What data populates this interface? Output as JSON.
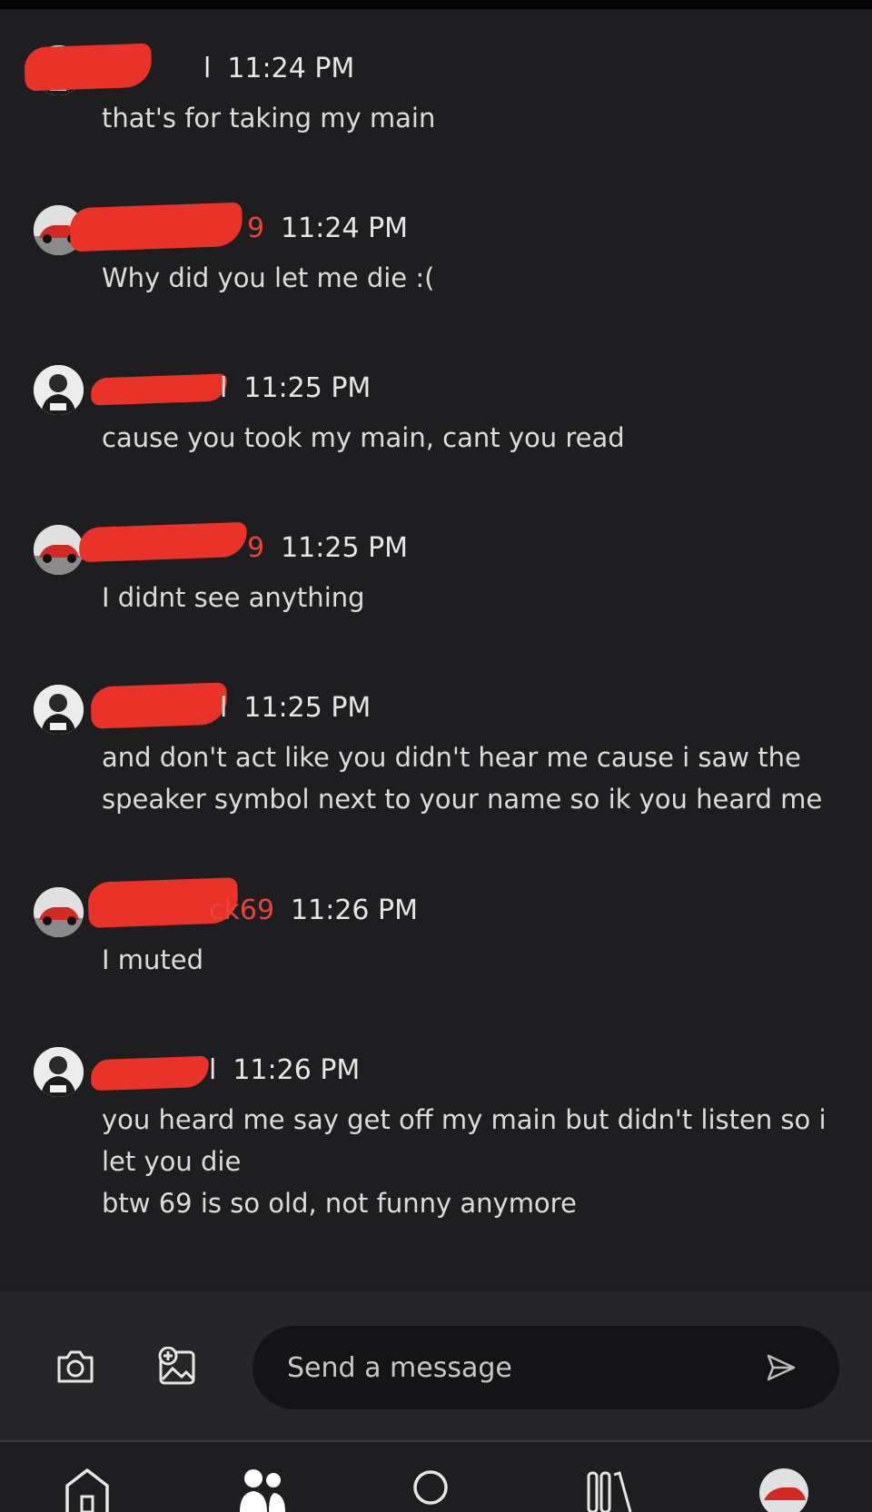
{
  "messages": [
    {
      "user": "l",
      "user_color": "#e9e9e9",
      "avatar": "person-avatar",
      "time": "11:24 PM",
      "text": "that's for taking my main"
    },
    {
      "user": "9",
      "user_color": "#e8443a",
      "avatar": "red-car-avatar",
      "time": "11:24 PM",
      "text": "Why did you let me die :("
    },
    {
      "user": "l",
      "user_color": "#e9e9e9",
      "avatar": "person-avatar",
      "time": "11:25 PM",
      "text": "cause you took my main, cant you read"
    },
    {
      "user": "9",
      "user_color": "#e8443a",
      "avatar": "red-car-avatar",
      "time": "11:25 PM",
      "text": "I didnt see anything"
    },
    {
      "user": "l",
      "user_color": "#e9e9e9",
      "avatar": "person-avatar",
      "time": "11:25 PM",
      "text": "and don't act like you didn't hear me cause i saw the speaker symbol next to your name so ik you heard me"
    },
    {
      "user": "ck69",
      "user_color": "#e8443a",
      "avatar": "red-car-avatar",
      "time": "11:26 PM",
      "text": "I muted"
    },
    {
      "user": "l",
      "user_color": "#e9e9e9",
      "avatar": "person-avatar",
      "time": "11:26 PM",
      "text": "you heard me say get off my main but didn't listen so i\nlet you die\nbtw 69 is so old, not funny anymore"
    }
  ],
  "composer": {
    "camera_icon": "camera-icon",
    "image_icon": "add-image-icon",
    "placeholder": "Send a message",
    "send_icon": "send-icon"
  },
  "nav": {
    "items": [
      "home-icon",
      "friends-icon",
      "search-icon",
      "library-icon",
      "profile-avatar"
    ]
  },
  "colors": {
    "background": "#1e1e20",
    "accent_red": "#e8443a",
    "redaction": "#e8322a"
  }
}
